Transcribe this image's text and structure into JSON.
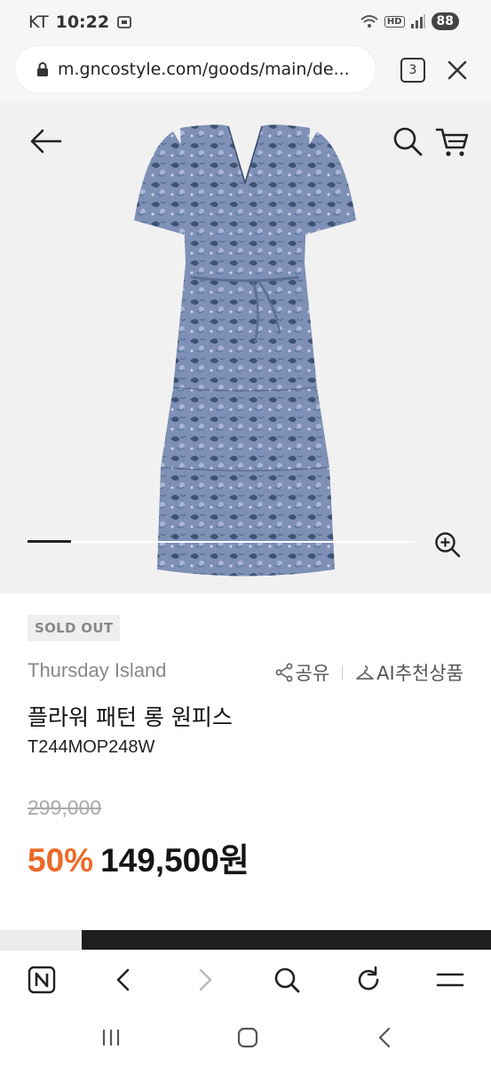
{
  "status_bar": {
    "carrier": "KT",
    "time": "10:22",
    "hd_label": "HD",
    "battery": "88"
  },
  "browser": {
    "url": "m.gncostyle.com/goods/main/de...",
    "tab_count": "3"
  },
  "product": {
    "badge": "SOLD OUT",
    "brand": "Thursday Island",
    "share_label": "공유",
    "ai_recommend_label": "AI추천상품",
    "title": "플라워 패턴 롱 원피스",
    "code": "T244MOP248W",
    "original_price": "299,000",
    "discount": "50%",
    "sale_price": "149,500원",
    "image_index": 1,
    "image_count": 9
  },
  "icons": {
    "back": "back-arrow-icon",
    "search": "search-icon",
    "cart": "cart-icon",
    "zoom": "zoom-in-icon"
  }
}
